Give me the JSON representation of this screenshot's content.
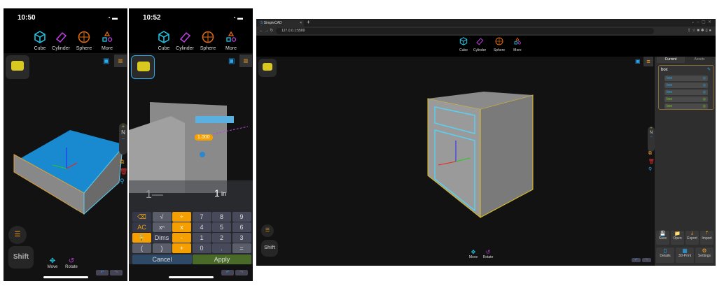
{
  "toolbar": {
    "cube": "Cube",
    "cylinder": "Cylinder",
    "sphere": "Sphere",
    "more": "More"
  },
  "phone1": {
    "time": "10:50",
    "side": {
      "zoom_in": "+",
      "north": "N",
      "zoom_out": "−"
    }
  },
  "phone2": {
    "time": "10:52",
    "dimension_label": "1.000",
    "calculator": {
      "expression": "1—",
      "value": "1",
      "unit": "in",
      "keys": [
        "⌫",
        "√",
        "÷",
        "7",
        "8",
        "9",
        "AC",
        "xⁿ",
        "x",
        "4",
        "5",
        "6",
        "🔓",
        "Dims",
        "-",
        "1",
        "2",
        "3",
        "(",
        ")",
        "+",
        "0",
        ".",
        "="
      ],
      "cancel": "Cancel",
      "apply": "Apply"
    }
  },
  "bottom": {
    "shift": "Shift",
    "move": "Move",
    "rotate": "Rotate",
    "undo": "↶",
    "redo": "↷"
  },
  "browser": {
    "tab_title": "SimpleCAD",
    "tab_close": "×",
    "new_tab": "+",
    "url": "127.0.0.1:5500",
    "panel": {
      "tabs": [
        "Current",
        "Assets"
      ],
      "object_name": "box",
      "items": [
        {
          "name": "box",
          "color": "#2aa8f0"
        },
        {
          "name": "box",
          "color": "#2aa8f0"
        },
        {
          "name": "box",
          "color": "#2aa8f0"
        },
        {
          "name": "box",
          "color": "#7cc820"
        },
        {
          "name": "box",
          "color": "#7cc820"
        }
      ],
      "actions": [
        "Save",
        "Open",
        "Export",
        "Import"
      ],
      "actions2": [
        "Details",
        "3D-Print",
        "Settings"
      ]
    }
  },
  "colors": {
    "accent": "#f5a000",
    "cube": "#22c8e8",
    "cylinder": "#c040e0",
    "sphere": "#e06a10",
    "apply": "#4a6a2a",
    "cancel": "#2e4a66"
  }
}
